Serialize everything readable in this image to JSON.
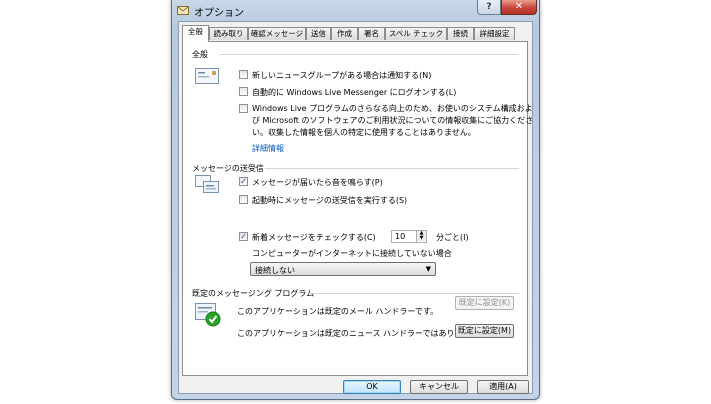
{
  "window": {
    "title": "オプション",
    "help": "?",
    "close": "✕"
  },
  "tabs": [
    "全般",
    "読み取り",
    "確認メッセージ",
    "送信",
    "作成",
    "署名",
    "スペル チェック",
    "接続",
    "詳細設定"
  ],
  "general": {
    "section_title": "全般",
    "options": [
      {
        "label": "新しいニュースグループがある場合は通知する(N)",
        "checked": false
      },
      {
        "label": "自動的に Windows Live Messenger にログオンする(L)",
        "checked": false
      }
    ],
    "improvement": {
      "lines": [
        "Windows Live プログラムのさらなる向上のため、お使いのシステム構成およ",
        "び Microsoft のソフトウェアのご利用状況についての情報収集にご協力くださ",
        "い。収集した情報を個人の特定に使用することはありません。"
      ],
      "checked": false
    },
    "details_link": "詳細情報"
  },
  "send_receive": {
    "section_title": "メッセージの送受信",
    "options": [
      {
        "label": "メッセージが届いたら音を鳴らす(P)",
        "checked": true
      },
      {
        "label": "起動時にメッセージの送受信を実行する(S)",
        "checked": false
      },
      {
        "label": "新着メッセージをチェックする(C)",
        "checked": true
      }
    ],
    "interval_value": "10",
    "interval_unit": "分ごと(I)",
    "offline_label": "コンピューターがインターネットに接続していない場合",
    "offline_option": "接続しない"
  },
  "default_programs": {
    "section_title": "既定のメッセージング プログラム",
    "mail_text": "このアプリケーションは既定のメール ハンドラーです。",
    "mail_button": "既定に設定(K)",
    "news_text": "このアプリケーションは既定のニュース ハンドラーではありません。",
    "news_button": "既定に設定(M)"
  },
  "footer": {
    "ok": "OK",
    "cancel": "キャンセル",
    "apply": "適用(A)"
  },
  "checkmark": "✓",
  "colors": {
    "link": "#0a56c3",
    "title_bar": "#c4d4e6",
    "check_badge": "#2aa32a"
  }
}
